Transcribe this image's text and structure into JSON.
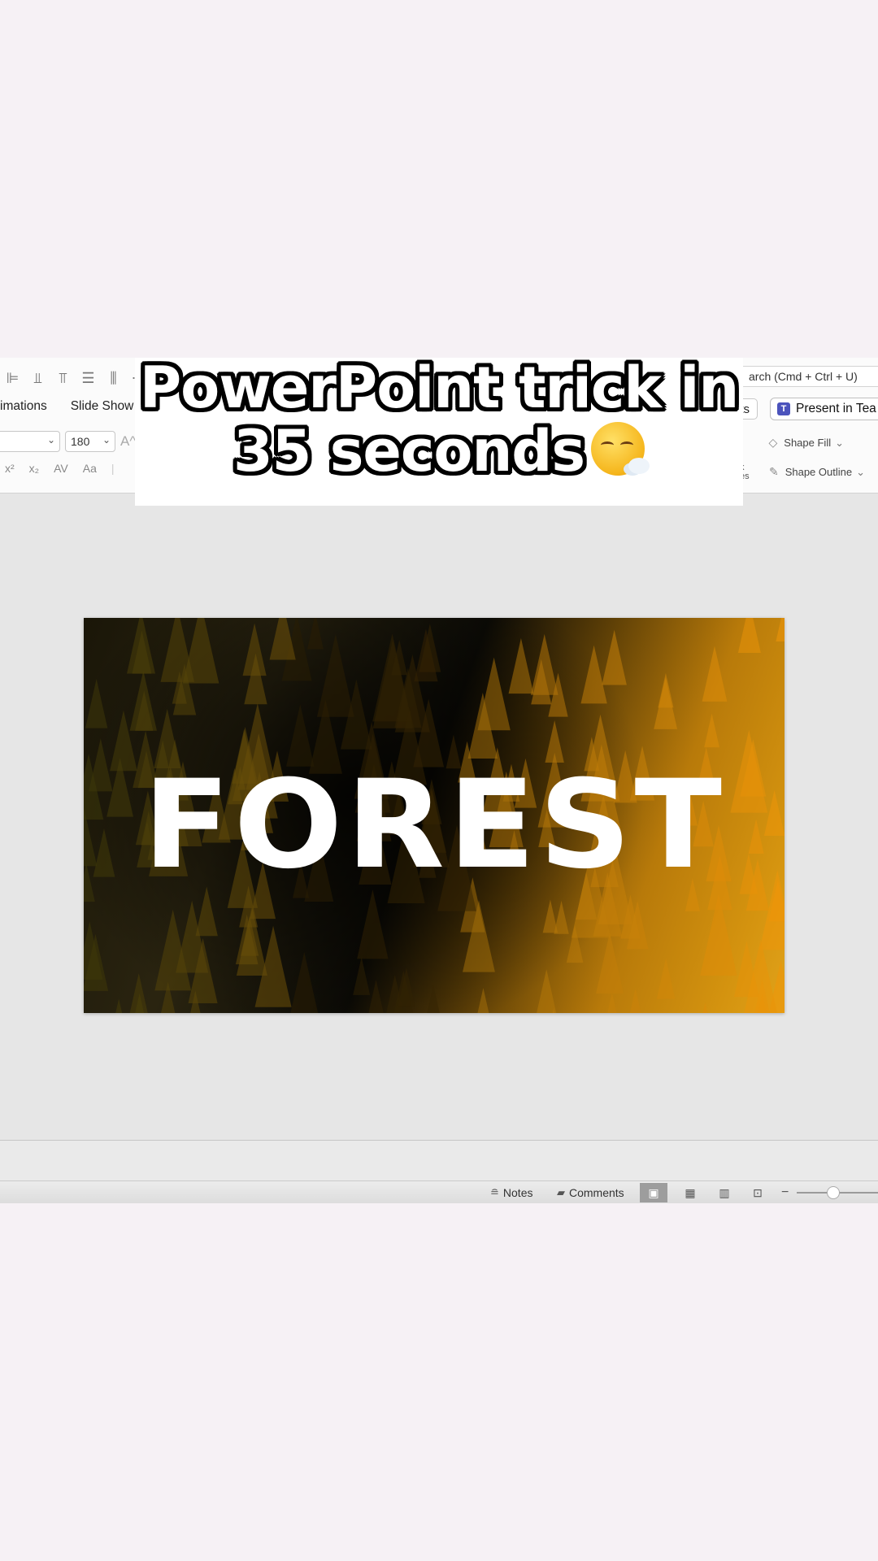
{
  "caption": {
    "line1": "PowerPoint trick in",
    "line2": "35 seconds",
    "emoji": "face-exhaling-emoji"
  },
  "ribbon": {
    "tabs": [
      "imations",
      "Slide Show"
    ],
    "font_name": "",
    "font_size": "180",
    "grow_font_glyph": "A^",
    "format_glyphs": [
      "x²",
      "x₂",
      "AV",
      "Aa"
    ],
    "search_placeholder": "arch (Cmd + Ctrl + U)",
    "comments_button": "ts",
    "present_button": "Present in Tea",
    "shape_fill": "Shape Fill",
    "shape_outline": "Shape Outline",
    "clipped_label": "k es"
  },
  "slide": {
    "title": "FOREST"
  },
  "status_bar": {
    "notes": "Notes",
    "comments": "Comments",
    "views": [
      "normal-view",
      "slide-sorter-view",
      "reading-view",
      "presenter-view"
    ],
    "active_view": "normal-view",
    "zoom_minus": "−"
  }
}
